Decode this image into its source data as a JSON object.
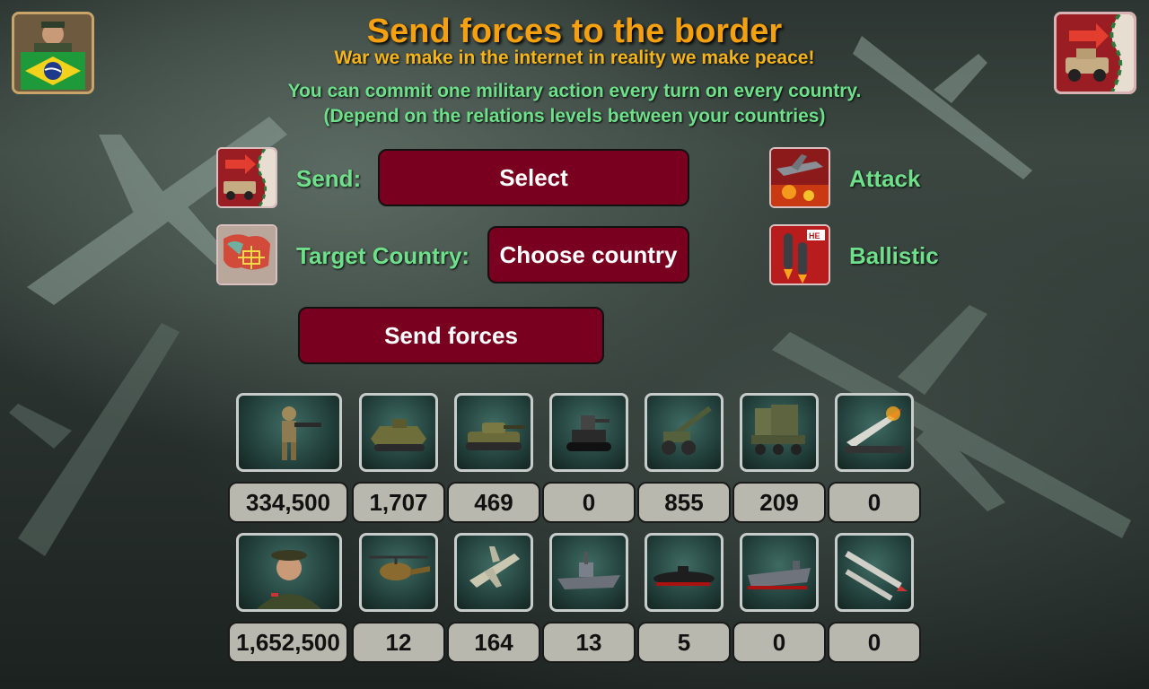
{
  "header": {
    "title": "Send forces to the border",
    "subtitle": "War we make in the internet in reality we make peace!",
    "info_line1": "You can commit one military action every turn on every country.",
    "info_line2": "(Depend on the relations levels between your countries)"
  },
  "player": {
    "flag": "brazil-flag",
    "portrait": "general-portrait"
  },
  "form": {
    "send_label": "Send:",
    "send_select": "Select",
    "target_label": "Target Country:",
    "target_select": "Choose country",
    "send_button": "Send forces"
  },
  "side_actions": {
    "attack_label": "Attack",
    "ballistic_label": "Ballistic"
  },
  "units_row1": [
    {
      "icon": "soldier-icon",
      "count": "334,500"
    },
    {
      "icon": "apc-icon",
      "count": "1,707"
    },
    {
      "icon": "tank-icon",
      "count": "469"
    },
    {
      "icon": "robot-vehicle-icon",
      "count": "0"
    },
    {
      "icon": "artillery-icon",
      "count": "855"
    },
    {
      "icon": "missile-launcher-truck-icon",
      "count": "209"
    },
    {
      "icon": "icbm-launcher-icon",
      "count": "0"
    }
  ],
  "units_row2": [
    {
      "icon": "officer-icon",
      "count": "1,652,500"
    },
    {
      "icon": "helicopter-icon",
      "count": "12"
    },
    {
      "icon": "fighter-jet-icon",
      "count": "164"
    },
    {
      "icon": "warship-icon",
      "count": "13"
    },
    {
      "icon": "submarine-icon",
      "count": "5"
    },
    {
      "icon": "aircraft-carrier-icon",
      "count": "0"
    },
    {
      "icon": "missiles-icon",
      "count": "0"
    }
  ],
  "colors": {
    "title": "#f5a10f",
    "info_green": "#6fe08a",
    "button": "#7a0020",
    "count_bg": "#b8b8ae"
  }
}
